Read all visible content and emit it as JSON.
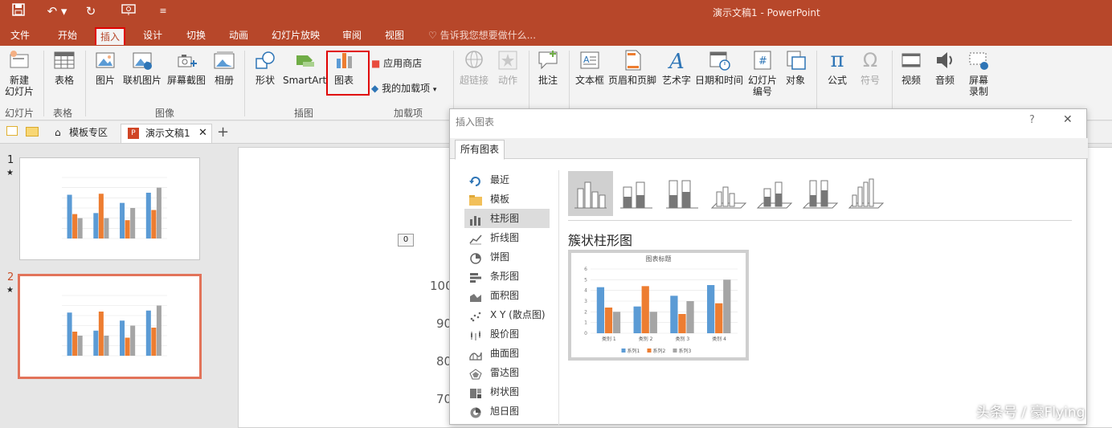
{
  "window": {
    "title": "演示文稿1 - PowerPoint"
  },
  "menu_tabs": [
    "文件",
    "开始",
    "插入",
    "设计",
    "切换",
    "动画",
    "幻灯片放映",
    "审阅",
    "视图"
  ],
  "tell_me": "告诉我您想要做什么...",
  "ribbon": {
    "new_slide": "新建\n幻灯片",
    "group_slides": "幻灯片",
    "table": "表格",
    "group_table": "表格",
    "picture": "图片",
    "online_picture": "联机图片",
    "screenshot": "屏幕截图",
    "album": "相册",
    "group_images": "图像",
    "shapes": "形状",
    "smartart": "SmartArt",
    "chart": "图表",
    "group_illustrations": "插图",
    "store": "应用商店",
    "my_addins": "我的加载项",
    "group_addins": "加载项",
    "hyperlink": "超链接",
    "action": "动作",
    "comment": "批注",
    "textbox": "文本框",
    "header_footer": "页眉和页脚",
    "wordart": "艺术字",
    "datetime": "日期和时间",
    "slide_number": "幻灯片\n编号",
    "object": "对象",
    "equation": "公式",
    "symbol": "符号",
    "video": "视频",
    "audio": "音频",
    "screen_record": "屏幕\n录制"
  },
  "doc_tabs": {
    "template": "模板专区",
    "doc": "演示文稿1"
  },
  "slides": [
    {
      "number": "1"
    },
    {
      "number": "2"
    }
  ],
  "canvas": {
    "comment_count": "0",
    "y_ticks": [
      "100",
      "90",
      "80",
      "70"
    ]
  },
  "dialog": {
    "title": "插入图表",
    "help": "?",
    "close": "✕",
    "tab": "所有图表",
    "categories": [
      "最近",
      "模板",
      "柱形图",
      "折线图",
      "饼图",
      "条形图",
      "面积图",
      "X Y (散点图)",
      "股价图",
      "曲面图",
      "雷达图",
      "树状图",
      "旭日图"
    ],
    "selected_category": "柱形图",
    "subtype_title": "簇状柱形图",
    "preview_chart": {
      "title": "图表标题",
      "categories": [
        "类别 1",
        "类别 2",
        "类别 3",
        "类别 4"
      ],
      "series": [
        {
          "name": "系列1",
          "values": [
            4.3,
            2.5,
            3.5,
            4.5
          ]
        },
        {
          "name": "系列2",
          "values": [
            2.4,
            4.4,
            1.8,
            2.8
          ]
        },
        {
          "name": "系列3",
          "values": [
            2,
            2,
            3,
            5
          ]
        }
      ],
      "y_ticks": [
        "0",
        "1",
        "2",
        "3",
        "4",
        "5",
        "6"
      ],
      "colors": [
        "#5b9bd5",
        "#ed7d31",
        "#a5a5a5"
      ]
    }
  },
  "watermark": "头条号 / 豪Flying",
  "colors": {
    "accent": "#b7472a",
    "highlight": "#e00000"
  }
}
